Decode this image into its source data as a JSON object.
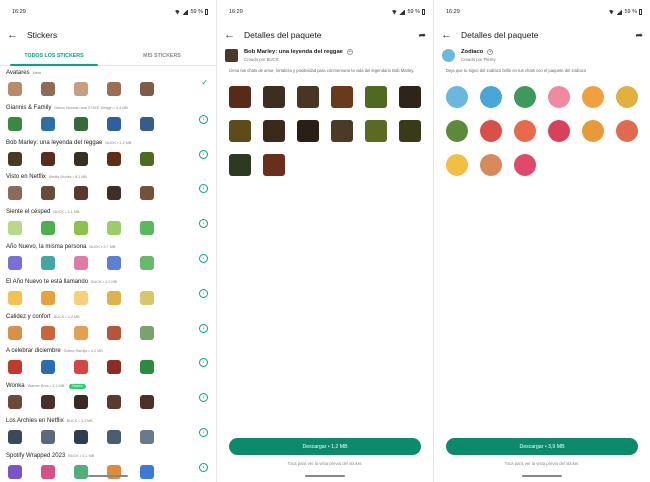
{
  "status_time": "16:29",
  "battery": "59 %",
  "screen1": {
    "title": "Stickers",
    "tabs": [
      "TODOS LOS STICKERS",
      "MIS STICKERS"
    ],
    "packs": [
      {
        "name": "Avatares",
        "meta": "Meta",
        "installed": true,
        "new": false,
        "colors": [
          "#b98b6a",
          "#8f6a55",
          "#c89f7e",
          "#9d6e54",
          "#7f5c48"
        ]
      },
      {
        "name": "Giannis & Family",
        "meta": "Marco Norman and STATE Design  •  4,4 MB",
        "installed": false,
        "new": false,
        "colors": [
          "#3a8a3e",
          "#2e6fa8",
          "#356a3a",
          "#2f5f9e",
          "#365c8a"
        ]
      },
      {
        "name": "Bob Marley: una leyenda del reggae",
        "meta": "BUCK  •  1,2 MB",
        "installed": false,
        "new": false,
        "colors": [
          "#4a3a24",
          "#5a2a1a",
          "#3b3020",
          "#5e2f14",
          "#4d6a1e"
        ]
      },
      {
        "name": "Visto en Netflix",
        "meta": "Media Monks  •  8,1 MB",
        "installed": false,
        "new": false,
        "colors": [
          "#8a6a5a",
          "#6a4a3a",
          "#5a3a2e",
          "#3e2e28",
          "#7a4e38"
        ]
      },
      {
        "name": "Siente el césped",
        "meta": "BUCK  •  3,1 MB",
        "installed": false,
        "new": false,
        "colors": [
          "#b9d98a",
          "#4caf50",
          "#8bc34a",
          "#9ccc65",
          "#5cb85c"
        ]
      },
      {
        "name": "Año Nuevo, la misma persona",
        "meta": "BUCK  •  3,7 MB",
        "installed": false,
        "new": false,
        "colors": [
          "#7b6ed6",
          "#3fa9a1",
          "#e07aa6",
          "#5d7fd6",
          "#66bb6a"
        ]
      },
      {
        "name": "El Año Nuevo te está llamando",
        "meta": "BUCK  •  4,2 MB",
        "installed": false,
        "new": false,
        "colors": [
          "#f2c14e",
          "#e9a23b",
          "#f5d27a",
          "#e0b24a",
          "#d8c76a"
        ]
      },
      {
        "name": "Calidez y confort",
        "meta": "BUCK  •  4,2 MB",
        "installed": false,
        "new": false,
        "colors": [
          "#d9904a",
          "#c9663a",
          "#e2a050",
          "#b5553a",
          "#7aa36a"
        ]
      },
      {
        "name": "A celebrar diciembre",
        "meta": "Sofiea Ramija  •  4,2 MB",
        "installed": false,
        "new": false,
        "colors": [
          "#c0392b",
          "#2a6db0",
          "#d64541",
          "#8e2c22",
          "#2e8b3e"
        ]
      },
      {
        "name": "Wonka",
        "meta": "Warner Bros  •  3,1 MB",
        "installed": false,
        "new": true,
        "badge": "Nuevo",
        "colors": [
          "#6b4a3a",
          "#4a2e2a",
          "#3a2a24",
          "#5a3a2e",
          "#4e3026"
        ]
      },
      {
        "name": "Los Archies en Netflix",
        "meta": "BUCK  •  3,3 MB",
        "installed": false,
        "new": false,
        "colors": [
          "#3a4a5a",
          "#5a6a7a",
          "#2f3e4e",
          "#4a5e6e",
          "#6a7a8a"
        ]
      },
      {
        "name": "Spotify Wrapped 2023",
        "meta": "BUCK  •  3,1 MB",
        "installed": false,
        "new": false,
        "colors": [
          "#7a55c9",
          "#d94f8a",
          "#4fb07a",
          "#e08a3a",
          "#3a7ad9"
        ]
      }
    ]
  },
  "screen2": {
    "title": "Detalles del paquete",
    "pack_name": "Bob Marley: una leyenda del reggae",
    "creator": "Creado por BUCK",
    "description": "Llena tus chats de amor, fortaleza y positividad para conmemorar la vida del legendario Bob Marley.",
    "download_label": "Descargar • 1,2 MB",
    "hint": "Toca para ver la vista previa del sticker.",
    "sticker_colors": [
      "#5a2a18",
      "#3e2e20",
      "#4a3422",
      "#6a3a1c",
      "#4e6a20",
      "#2e2418",
      "#5e4a1a",
      "#3a2a1a",
      "#2a1e16",
      "#4a3a26",
      "#5a6a22",
      "#3a3a18",
      "#2e3a20",
      "#6a2e1a"
    ]
  },
  "screen3": {
    "title": "Detalles del paquete",
    "pack_name": "Zodíaco",
    "creator": "Creado por Plenty",
    "description": "Deja que tu signo del zodíaco brille en tus chats con el paquete del zodíaco",
    "download_label": "Descargar • 3,9 MB",
    "hint": "Toca para ver la vista previa del sticker.",
    "sticker_colors": [
      "#6ab7e0",
      "#4aa6d8",
      "#3e9a5a",
      "#f08aa0",
      "#f0a040",
      "#e0b040",
      "#5a8a3a",
      "#d9504a",
      "#e86a4a",
      "#d9405a",
      "#e89a3a",
      "#e06a50",
      "#f0c040",
      "#d98a5a",
      "#e04a6a"
    ]
  }
}
